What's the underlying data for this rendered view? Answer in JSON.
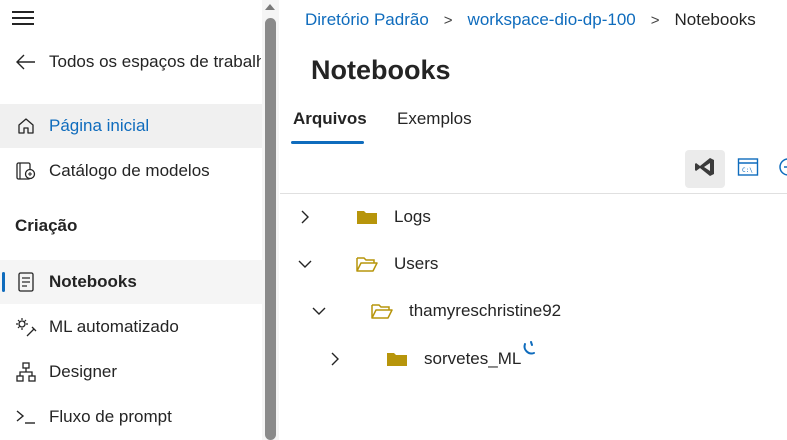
{
  "sidebar": {
    "back_label": "Todos os espaços de trabalho",
    "items": [
      {
        "label": "Página inicial",
        "icon": "home-icon"
      },
      {
        "label": "Catálogo de modelos",
        "icon": "model-catalog-icon"
      }
    ],
    "section_title": "Criação",
    "creation_items": [
      {
        "label": "Notebooks",
        "icon": "notebook-icon",
        "selected": true
      },
      {
        "label": "ML automatizado",
        "icon": "automl-icon"
      },
      {
        "label": "Designer",
        "icon": "designer-icon"
      },
      {
        "label": "Fluxo de prompt",
        "icon": "prompt-flow-icon"
      }
    ]
  },
  "breadcrumb": {
    "items": [
      "Diretório Padrão",
      "workspace-dio-dp-100",
      "Notebooks"
    ],
    "separator": ">"
  },
  "page": {
    "title": "Notebooks",
    "tabs": [
      {
        "label": "Arquivos",
        "selected": true
      },
      {
        "label": "Exemplos",
        "selected": false
      }
    ]
  },
  "toolbar": {
    "icons": [
      "vscode-icon",
      "terminal-icon",
      "add-icon"
    ]
  },
  "tree": [
    {
      "label": "Logs",
      "expanded": false,
      "level": 0
    },
    {
      "label": "Users",
      "expanded": true,
      "level": 0
    },
    {
      "label": "thamyreschristine92",
      "expanded": true,
      "level": 1
    },
    {
      "label": "sorvetes_ML",
      "expanded": false,
      "level": 2,
      "loading": true
    }
  ],
  "colors": {
    "accent": "#0f6cbd",
    "folder": "#b7950b",
    "selected_bg": "#f0f0f0",
    "text": "#242424"
  }
}
